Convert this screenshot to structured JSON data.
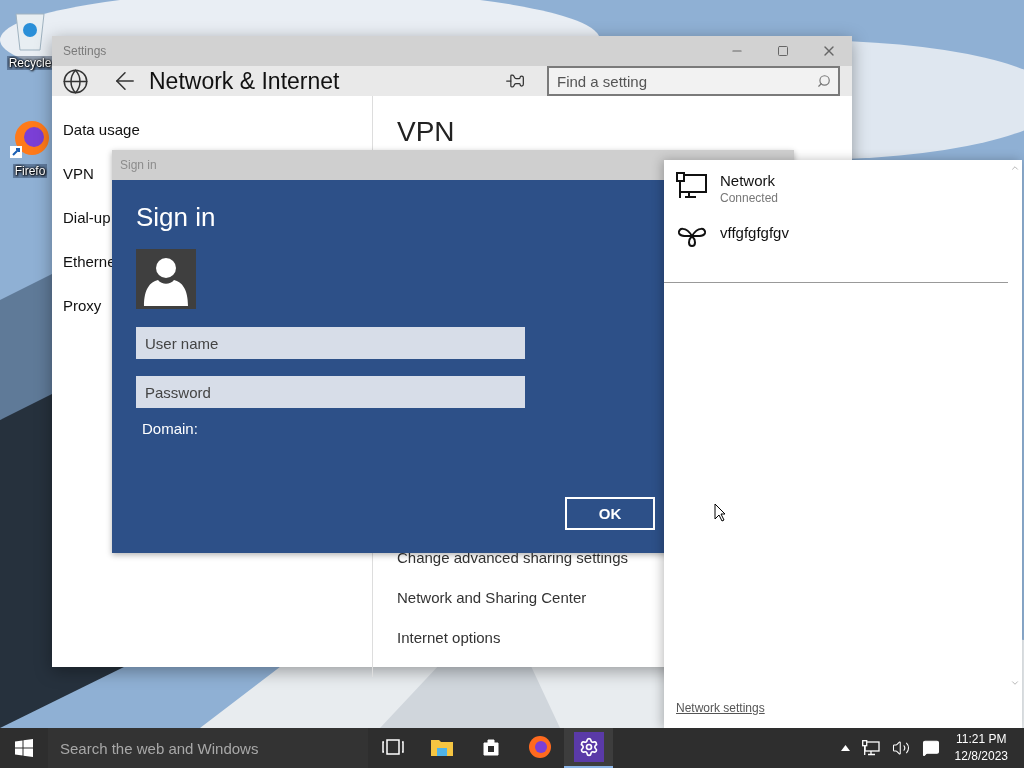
{
  "desktop": {
    "icons": [
      {
        "label": "Recycle",
        "kind": "recycle"
      },
      {
        "label": "Firefo",
        "kind": "firefox"
      }
    ]
  },
  "settings_window": {
    "title": "Settings",
    "header": "Network & Internet",
    "search": {
      "placeholder": "Find a setting"
    },
    "sidebar": {
      "items": [
        "Data usage",
        "VPN",
        "Dial-up",
        "Etherne",
        "Proxy"
      ]
    },
    "content": {
      "heading": "VPN",
      "links": [
        "Change advanced sharing settings",
        "Network and Sharing Center",
        "Internet options"
      ]
    }
  },
  "sign_in_dialog": {
    "title": "Sign in",
    "heading": "Sign in",
    "fields": [
      {
        "placeholder": "User name"
      },
      {
        "placeholder": "Password"
      }
    ],
    "domain_label": "Domain:",
    "buttons": [
      "OK"
    ]
  },
  "network_flyout": {
    "items": [
      {
        "name": "Network",
        "status": "Connected",
        "kind": "ethernet"
      },
      {
        "name": "vffgfgfgfgv",
        "kind": "dialup"
      }
    ],
    "settings_link": "Network settings"
  },
  "taskbar": {
    "search": {
      "placeholder": "Search the web and Windows"
    },
    "apps": [
      {
        "kind": "task-view",
        "selected": false
      },
      {
        "kind": "file-explorer",
        "selected": false
      },
      {
        "kind": "store",
        "selected": false
      },
      {
        "kind": "firefox",
        "selected": false
      },
      {
        "kind": "settings",
        "selected": true
      }
    ],
    "clock": {
      "time": "11:21 PM",
      "date": "12/8/2023"
    }
  }
}
